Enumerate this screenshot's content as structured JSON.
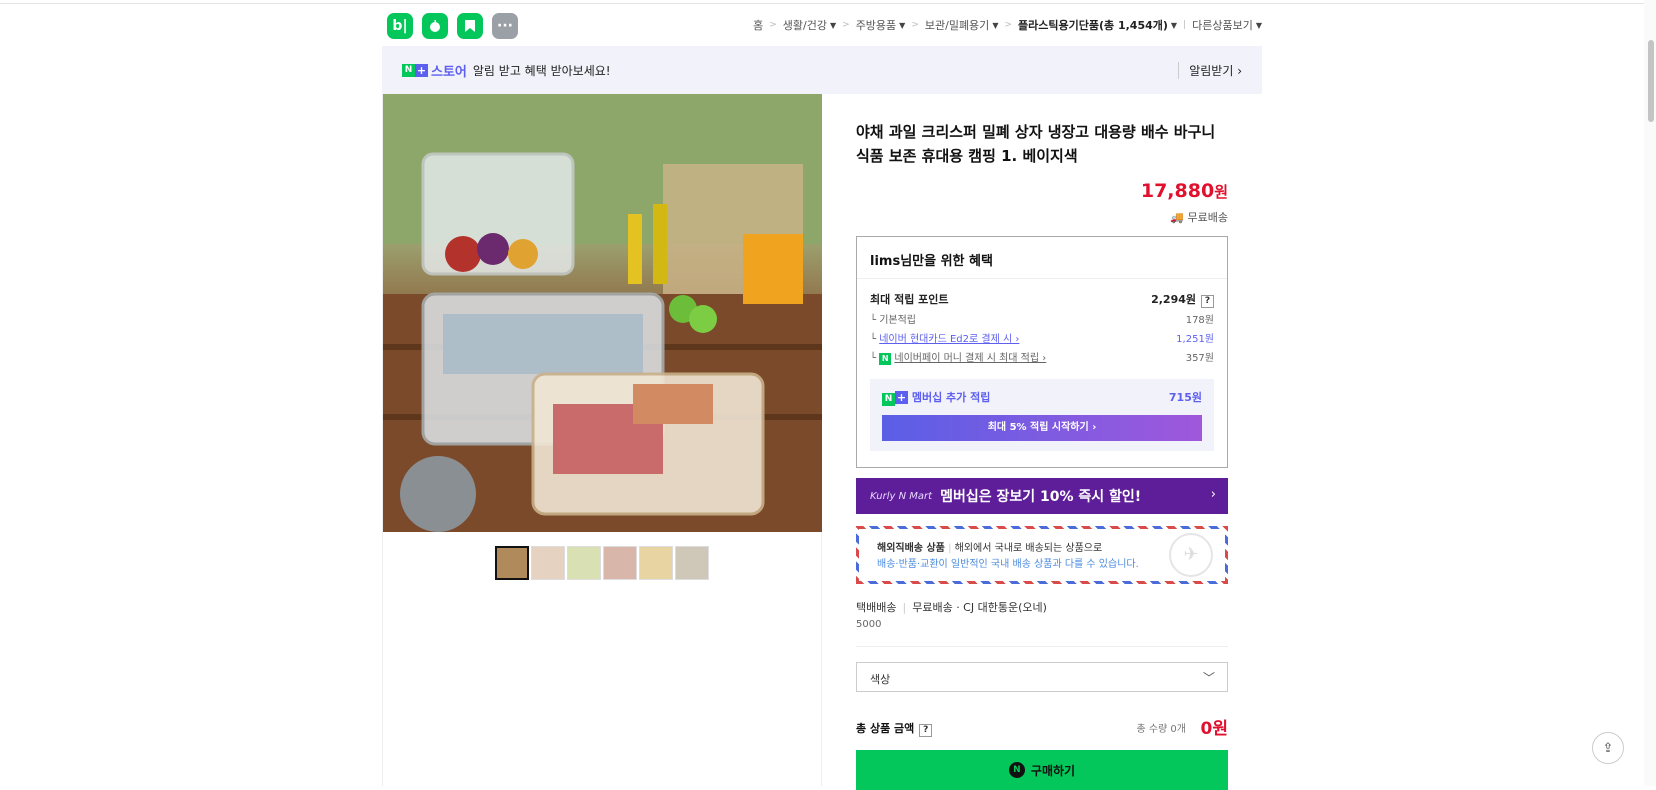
{
  "header": {
    "apps": [
      {
        "label": "b|",
        "icon": "blog-icon"
      },
      {
        "label": "",
        "icon": "apple-icon"
      },
      {
        "label": "",
        "icon": "bookmark-icon"
      },
      {
        "label": "···",
        "icon": "more-icon"
      }
    ],
    "breadcrumbs": [
      "홈",
      "생활/건강",
      "주방용품",
      "보관/밀폐용기",
      "플라스틱용기단품(총 1,454개)",
      "다른상품보기"
    ]
  },
  "notify": {
    "brand": "스토어",
    "message": "알림 받고 혜택 받아보세요!",
    "action": "알림받기 ›"
  },
  "product": {
    "title": "야채 과일 크리스퍼 밀폐 상자 냉장고 대용량 배수 바구니 식품 보존 휴대용 캠핑 1. 베이지색",
    "price": "17,880",
    "price_unit": "원",
    "shipping": "무료배송"
  },
  "benefit": {
    "title": "lims님만을 위한 혜택",
    "max_points_label": "최대 적립 포인트",
    "max_points_value": "2,294원",
    "rows": [
      {
        "label": "기본적립",
        "value": "178원"
      },
      {
        "label": "네이버 현대카드 Ed2로 결제 시 ›",
        "value": "1,251원"
      },
      {
        "label": "네이버페이 머니 결제 시 최대 적립 ›",
        "value": "357원"
      }
    ],
    "member_label": "멤버십 추가 적립",
    "member_value": "715원",
    "member_button": "최대 5% 적립 시작하기 ›"
  },
  "kurly": {
    "logo": "Kurly N Mart",
    "text": "멤버십은 장보기 10% 즉시 할인!",
    "chevron": "›"
  },
  "overseas": {
    "title": "해외직배송 상품",
    "desc": "해외에서 국내로 배송되는 상품으로",
    "note": "배송·반품·교환이 일반적인 국내 배송 상품과 다를 수 있습니다."
  },
  "delivery": {
    "method": "택배배송",
    "fee_type": "무료배송",
    "carrier": "· CJ 대한통운(오네)",
    "fee": "5000"
  },
  "option": {
    "placeholder": "색상"
  },
  "total": {
    "label": "총 상품 금액",
    "qty": "총 수량 0개",
    "amount": "0원"
  },
  "buy": {
    "label": "구매하기"
  },
  "colors": {
    "accent": "#03c75a",
    "price": "#e0102e",
    "naverplus": "#5d5fef",
    "kurly": "#5f1e99"
  }
}
